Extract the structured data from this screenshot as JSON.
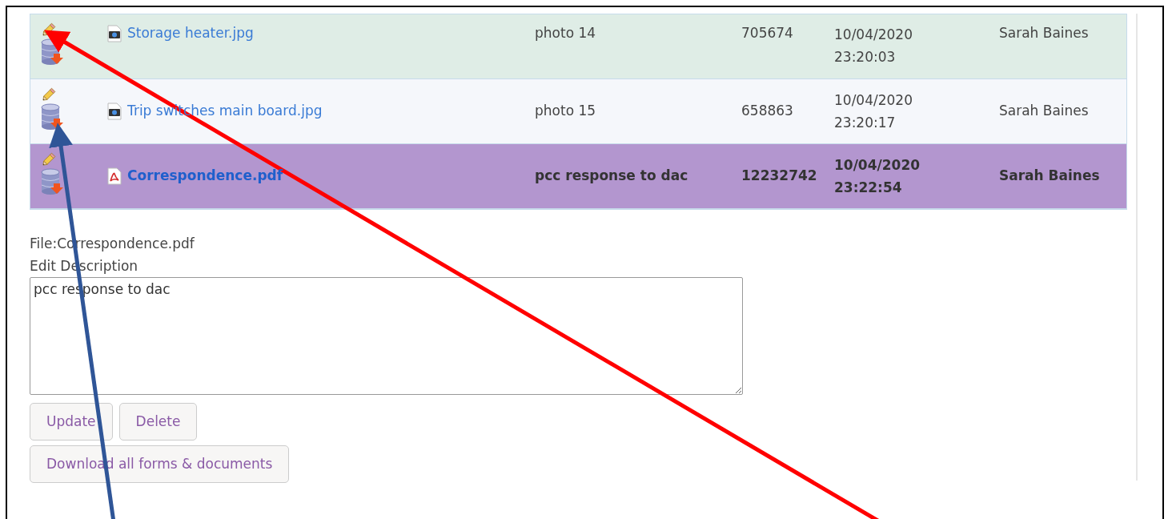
{
  "files": [
    {
      "name": "Storage heater.jpg",
      "kind": "image",
      "description": "photo 14",
      "size": "705674",
      "date": "10/04/2020",
      "time": "23:20:03",
      "uploaded_by": "Sarah Baines",
      "selected": false
    },
    {
      "name": "Trip switches main board.jpg",
      "kind": "image",
      "description": "photo 15",
      "size": "658863",
      "date": "10/04/2020",
      "time": "23:20:17",
      "uploaded_by": "Sarah Baines",
      "selected": false
    },
    {
      "name": "Correspondence.pdf",
      "kind": "pdf",
      "description": "pcc response to dac",
      "size": "12232742",
      "date": "10/04/2020",
      "time": "23:22:54",
      "uploaded_by": "Sarah Baines",
      "selected": true
    }
  ],
  "edit_form": {
    "file_label": "File:Correspondence.pdf",
    "description_label": "Edit Description",
    "description_value": "pcc response to dac",
    "buttons": [
      "Update",
      "Delete"
    ],
    "download_button": "Download all forms & documents"
  }
}
